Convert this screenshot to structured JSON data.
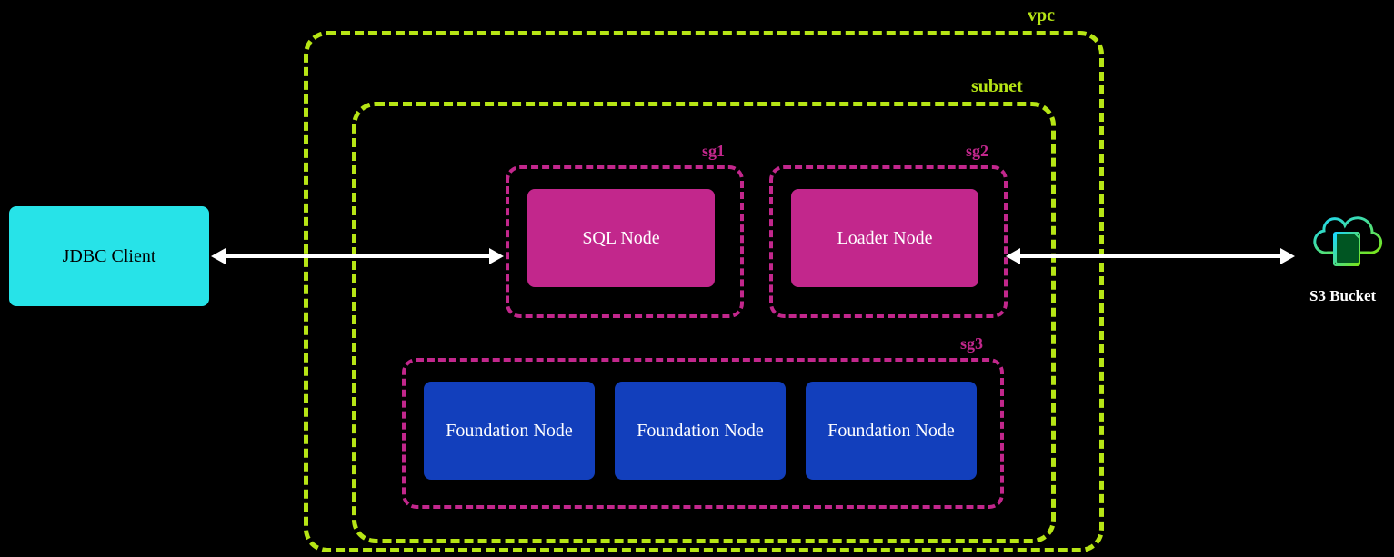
{
  "labels": {
    "vpc": "vpc",
    "subnet": "subnet",
    "sg1": "sg1",
    "sg2": "sg2",
    "sg3": "sg3",
    "s3": "S3 Bucket"
  },
  "nodes": {
    "jdbc": "JDBC Client",
    "sql": "SQL Node",
    "loader": "Loader Node",
    "foundation1": "Foundation Node",
    "foundation2": "Foundation Node",
    "foundation3": "Foundation Node"
  },
  "colors": {
    "background": "#000000",
    "vpc_border": "#b6e515",
    "sg_border": "#c2278c",
    "jdbc_fill": "#27e3e8",
    "sql_fill": "#c2278c",
    "foundation_fill": "#123fbc",
    "arrow": "#ffffff"
  },
  "icons": {
    "s3_bucket": "bucket-icon"
  }
}
